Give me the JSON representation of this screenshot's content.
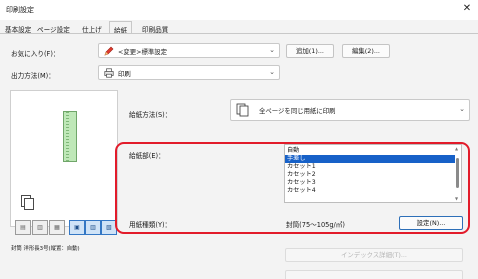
{
  "window": {
    "title": "印刷設定",
    "close_symbol": "✕"
  },
  "tabs": [
    {
      "label": "基本設定",
      "active": false
    },
    {
      "label": "ページ設定",
      "active": false
    },
    {
      "label": "仕上げ",
      "active": false
    },
    {
      "label": "給紙",
      "active": true
    },
    {
      "label": "印刷品質",
      "active": false
    }
  ],
  "favorites": {
    "label": "お気に入り(F)：",
    "value": "<変更>標準設定",
    "add_button": "追加(1)...",
    "edit_button": "編集(2)..."
  },
  "output_method": {
    "label": "出力方法(M)：",
    "value": "印刷"
  },
  "preview": {
    "status_text": "封筒 洋形長3号(縦置：自動)"
  },
  "paper_feed_method": {
    "label": "給紙方法(S)：",
    "value": "全ページを同じ用紙に印刷"
  },
  "paper_source": {
    "label": "給紙部(E)：",
    "options": [
      "自動",
      "手差し",
      "カセット1",
      "カセット2",
      "カセット3",
      "カセット4"
    ],
    "selected_index": 1
  },
  "paper_type": {
    "label": "用紙種類(Y)：",
    "value": "封筒(75～105g/㎡)",
    "settings_button": "設定(N)..."
  },
  "tab_paper_button": "インデックス詳細(T)...",
  "colors": {
    "highlight_border": "#e21b2a",
    "selection": "#1761c8"
  }
}
